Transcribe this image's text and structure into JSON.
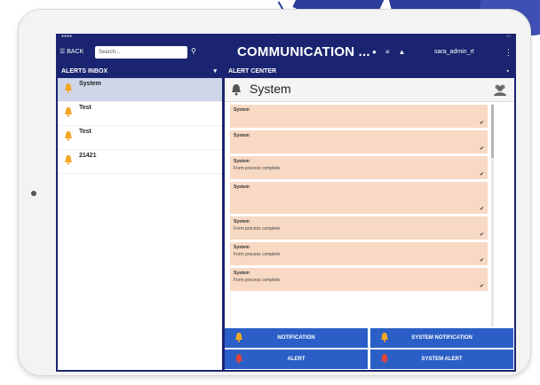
{
  "colors": {
    "navbar": "#1a2470",
    "selected_row": "#cfd6ea",
    "message_bg": "#f8d9c4",
    "action_button": "#2b5fc7",
    "bell_orange": "#f5a623",
    "bell_red": "#e0433a"
  },
  "navbar": {
    "back_label": "BACK",
    "search_placeholder": "Search...",
    "title": "COMMUNICATION ...",
    "user": "sara_admin_rt",
    "icons": [
      "chat-icon",
      "list-icon",
      "bell-icon",
      "menu-icon"
    ]
  },
  "inbox": {
    "header": "ALERTS INBOX",
    "items": [
      {
        "title": "System",
        "subtitle": "",
        "date": "",
        "bell": "orange",
        "selected": true
      },
      {
        "title": "Test",
        "subtitle": "",
        "date": "",
        "bell": "orange",
        "selected": false
      },
      {
        "title": "Test",
        "subtitle": "",
        "date": "",
        "bell": "orange",
        "selected": false
      },
      {
        "title": "21421",
        "subtitle": "",
        "date": "",
        "bell": "orange",
        "selected": false
      }
    ]
  },
  "center": {
    "header": "ALERT CENTER",
    "system_title": "System",
    "messages": [
      {
        "from": "System",
        "date": "",
        "body": ""
      },
      {
        "from": "System",
        "date": "",
        "body": ""
      },
      {
        "from": "System",
        "date": "",
        "body": "Form process complete"
      },
      {
        "from": "System",
        "date": "",
        "body": ""
      },
      {
        "from": "System",
        "date": "",
        "body": "Form process complete"
      },
      {
        "from": "System",
        "date": "",
        "body": "Form process complete"
      },
      {
        "from": "System",
        "date": "",
        "body": "Form process complete"
      }
    ]
  },
  "actions": {
    "notification": "NOTIFICATION",
    "system_notification": "SYSTEM NOTIFICATION",
    "alert": "ALERT",
    "system_alert": "SYSTEM ALERT"
  }
}
